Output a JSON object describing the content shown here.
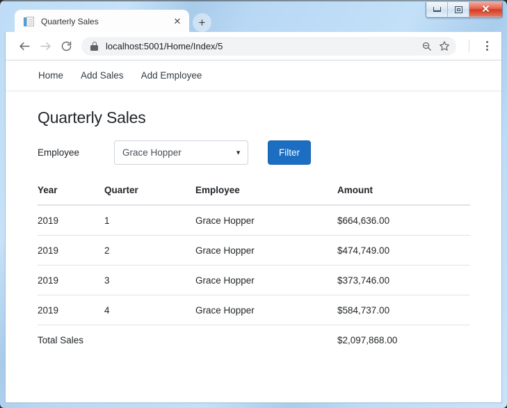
{
  "window": {
    "controls": {
      "minimize_label": "Minimize",
      "maximize_label": "Maximize",
      "close_label": "✕"
    }
  },
  "browser": {
    "tab": {
      "title": "Quarterly Sales",
      "close_label": "✕",
      "favicon": "document-icon"
    },
    "new_tab_label": "+",
    "toolbar": {
      "back_label": "Back",
      "forward_label": "Forward",
      "reload_label": "Reload",
      "url": "localhost:5001/Home/Index/5",
      "security": "lock-icon",
      "zoom_out_icon": "zoom-out-icon",
      "bookmark_icon": "star-icon",
      "menu_icon": "kebab-menu-icon"
    }
  },
  "site": {
    "nav": [
      {
        "label": "Home"
      },
      {
        "label": "Add Sales"
      },
      {
        "label": "Add Employee"
      }
    ],
    "heading": "Quarterly Sales",
    "filter": {
      "label": "Employee",
      "selected": "Grace Hopper",
      "caret": "▼",
      "button": "Filter"
    },
    "table": {
      "headers": [
        "Year",
        "Quarter",
        "Employee",
        "Amount"
      ],
      "rows": [
        {
          "year": "2019",
          "quarter": "1",
          "employee": "Grace Hopper",
          "amount": "$664,636.00"
        },
        {
          "year": "2019",
          "quarter": "2",
          "employee": "Grace Hopper",
          "amount": "$474,749.00"
        },
        {
          "year": "2019",
          "quarter": "3",
          "employee": "Grace Hopper",
          "amount": "$373,746.00"
        },
        {
          "year": "2019",
          "quarter": "4",
          "employee": "Grace Hopper",
          "amount": "$584,737.00"
        }
      ],
      "total_label": "Total Sales",
      "total_amount": "$2,097,868.00"
    }
  },
  "colors": {
    "primary": "#1b6ec2",
    "titlebar": "#bedcf6",
    "close_button": "#d33b27",
    "text": "#212529"
  }
}
